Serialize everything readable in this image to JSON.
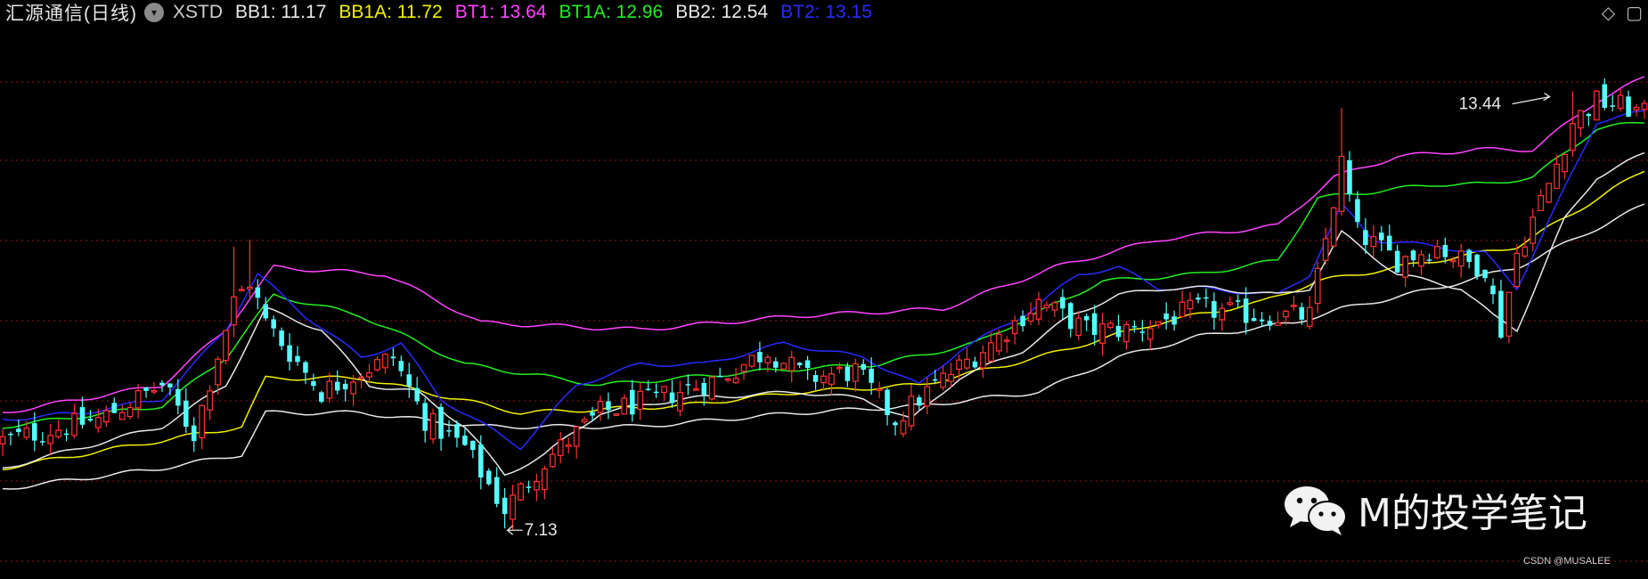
{
  "header": {
    "stock_name": "汇源通信(日线)",
    "indicator_name": "XSTD",
    "values": [
      {
        "label": "BB1",
        "value": "11.17",
        "color": "#e8e8e8"
      },
      {
        "label": "BB1A",
        "value": "11.72",
        "color": "#f0f000"
      },
      {
        "label": "BT1",
        "value": "13.64",
        "color": "#ff44ff"
      },
      {
        "label": "BT1A",
        "value": "12.96",
        "color": "#22ee22"
      },
      {
        "label": "BB2",
        "value": "12.54",
        "color": "#e8e8e8"
      },
      {
        "label": "BT2",
        "value": "13.15",
        "color": "#2a2aff"
      }
    ]
  },
  "watermark": {
    "brand": "M的投学笔记",
    "credit": "CSDN @MUSALEE"
  },
  "chart_data": {
    "type": "candlestick",
    "ylim": [
      6.4,
      14.4
    ],
    "grid": true,
    "annotations": [
      {
        "text": "13.44",
        "x": 195
      },
      {
        "text": "7.13",
        "x": 63
      }
    ],
    "colors": {
      "up": "#ff3333",
      "down": "#55ffff",
      "BB1": "#e8e8e8",
      "BB1A": "#f0f000",
      "BT1": "#ff44ff",
      "BT1A": "#22ee22",
      "BB2": "#e8e8e8",
      "BT2": "#2a2aff",
      "grid": "#7a1414"
    },
    "close_anchors": [
      [
        0,
        8.4
      ],
      [
        12,
        8.7
      ],
      [
        20,
        9.2
      ],
      [
        24,
        8.5
      ],
      [
        29,
        10.4
      ],
      [
        31,
        10.7
      ],
      [
        33,
        10.1
      ],
      [
        40,
        9.1
      ],
      [
        45,
        9.4
      ],
      [
        49,
        9.6
      ],
      [
        53,
        8.7
      ],
      [
        58,
        8.3
      ],
      [
        63,
        7.4
      ],
      [
        68,
        8.1
      ],
      [
        75,
        8.8
      ],
      [
        82,
        9.0
      ],
      [
        90,
        9.3
      ],
      [
        96,
        9.7
      ],
      [
        101,
        9.3
      ],
      [
        107,
        9.4
      ],
      [
        112,
        8.7
      ],
      [
        117,
        9.2
      ],
      [
        124,
        9.8
      ],
      [
        130,
        10.4
      ],
      [
        136,
        10.0
      ],
      [
        142,
        10.0
      ],
      [
        150,
        10.3
      ],
      [
        158,
        10.2
      ],
      [
        164,
        10.2
      ],
      [
        168,
        12.4
      ],
      [
        170,
        11.4
      ],
      [
        175,
        11.0
      ],
      [
        180,
        11.2
      ],
      [
        183,
        11.0
      ],
      [
        186,
        10.9
      ],
      [
        188,
        10.0
      ],
      [
        190,
        11.1
      ],
      [
        194,
        12.1
      ],
      [
        197,
        13.0
      ],
      [
        200,
        13.3
      ],
      [
        204,
        13.2
      ],
      [
        206,
        13.1
      ]
    ],
    "bands": {
      "BB2": [
        [
          0,
          7.7
        ],
        [
          20,
          8.0
        ],
        [
          30,
          8.2
        ],
        [
          33,
          8.8
        ],
        [
          45,
          8.8
        ],
        [
          60,
          8.6
        ],
        [
          80,
          8.6
        ],
        [
          100,
          8.8
        ],
        [
          115,
          8.9
        ],
        [
          130,
          9.1
        ],
        [
          140,
          9.6
        ],
        [
          150,
          9.9
        ],
        [
          162,
          10.1
        ],
        [
          168,
          10.3
        ],
        [
          180,
          10.6
        ],
        [
          190,
          10.9
        ],
        [
          206,
          11.8
        ]
      ],
      "BB1A": [
        [
          0,
          8.0
        ],
        [
          20,
          8.4
        ],
        [
          30,
          8.6
        ],
        [
          33,
          9.3
        ],
        [
          45,
          9.3
        ],
        [
          65,
          8.8
        ],
        [
          85,
          8.9
        ],
        [
          100,
          9.1
        ],
        [
          115,
          9.2
        ],
        [
          130,
          9.6
        ],
        [
          145,
          10.1
        ],
        [
          158,
          10.4
        ],
        [
          165,
          10.7
        ],
        [
          180,
          11.0
        ],
        [
          190,
          11.2
        ],
        [
          206,
          12.3
        ]
      ],
      "BT1A": [
        [
          0,
          8.6
        ],
        [
          20,
          8.9
        ],
        [
          28,
          9.6
        ],
        [
          34,
          10.5
        ],
        [
          45,
          10.2
        ],
        [
          58,
          9.5
        ],
        [
          75,
          9.2
        ],
        [
          95,
          9.4
        ],
        [
          110,
          9.5
        ],
        [
          122,
          9.8
        ],
        [
          138,
          10.7
        ],
        [
          150,
          10.8
        ],
        [
          160,
          11.0
        ],
        [
          165,
          11.9
        ],
        [
          180,
          12.1
        ],
        [
          186,
          12.1
        ],
        [
          192,
          12.2
        ],
        [
          200,
          12.9
        ],
        [
          206,
          13.0
        ]
      ],
      "BT1": [
        [
          0,
          8.8
        ],
        [
          20,
          9.2
        ],
        [
          28,
          10.0
        ],
        [
          34,
          10.9
        ],
        [
          48,
          10.8
        ],
        [
          60,
          10.1
        ],
        [
          80,
          10.0
        ],
        [
          100,
          10.2
        ],
        [
          118,
          10.3
        ],
        [
          132,
          10.9
        ],
        [
          145,
          11.3
        ],
        [
          160,
          11.5
        ],
        [
          167,
          12.2
        ],
        [
          175,
          12.5
        ],
        [
          185,
          12.6
        ],
        [
          192,
          12.6
        ],
        [
          200,
          13.3
        ],
        [
          206,
          13.64
        ]
      ],
      "BT2": [
        [
          0,
          8.7
        ],
        [
          10,
          8.8
        ],
        [
          20,
          9.0
        ],
        [
          28,
          10.0
        ],
        [
          32,
          10.8
        ],
        [
          38,
          10.2
        ],
        [
          45,
          9.6
        ],
        [
          50,
          9.8
        ],
        [
          55,
          9.0
        ],
        [
          65,
          8.3
        ],
        [
          72,
          9.2
        ],
        [
          80,
          9.5
        ],
        [
          88,
          9.5
        ],
        [
          98,
          9.8
        ],
        [
          108,
          9.6
        ],
        [
          115,
          9.2
        ],
        [
          120,
          9.7
        ],
        [
          128,
          10.2
        ],
        [
          135,
          10.8
        ],
        [
          140,
          10.9
        ],
        [
          145,
          10.6
        ],
        [
          150,
          10.6
        ],
        [
          160,
          10.5
        ],
        [
          164,
          10.8
        ],
        [
          168,
          11.8
        ],
        [
          172,
          11.3
        ],
        [
          180,
          11.2
        ],
        [
          186,
          11.1
        ],
        [
          190,
          10.6
        ],
        [
          195,
          11.8
        ],
        [
          200,
          13.0
        ],
        [
          206,
          13.15
        ]
      ],
      "BB1": [
        [
          0,
          8.0
        ],
        [
          20,
          8.6
        ],
        [
          28,
          9.2
        ],
        [
          33,
          10.3
        ],
        [
          40,
          10.0
        ],
        [
          46,
          9.2
        ],
        [
          52,
          9.1
        ],
        [
          58,
          8.6
        ],
        [
          63,
          7.9
        ],
        [
          68,
          8.2
        ],
        [
          75,
          8.8
        ],
        [
          85,
          9.0
        ],
        [
          100,
          9.1
        ],
        [
          108,
          9.0
        ],
        [
          114,
          8.7
        ],
        [
          120,
          9.3
        ],
        [
          128,
          9.7
        ],
        [
          134,
          10.2
        ],
        [
          140,
          10.5
        ],
        [
          146,
          10.6
        ],
        [
          152,
          10.6
        ],
        [
          160,
          10.5
        ],
        [
          164,
          10.6
        ],
        [
          168,
          11.4
        ],
        [
          175,
          10.8
        ],
        [
          183,
          10.6
        ],
        [
          187,
          10.2
        ],
        [
          190,
          10.0
        ],
        [
          196,
          11.6
        ],
        [
          200,
          12.2
        ],
        [
          206,
          12.54
        ]
      ]
    },
    "spikes": [
      [
        29,
        11.2
      ],
      [
        31,
        11.3
      ],
      [
        168,
        13.2
      ],
      [
        197,
        13.44
      ],
      [
        63,
        7.13
      ]
    ]
  }
}
